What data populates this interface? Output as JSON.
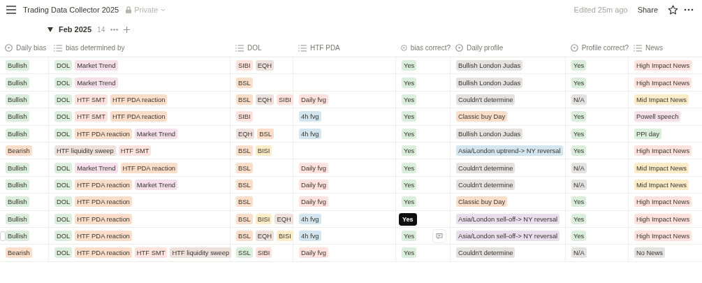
{
  "topbar": {
    "title": "Trading Data Collector 2025",
    "privacy": "Private",
    "edited": "Edited 25m ago",
    "share": "Share"
  },
  "group": {
    "label": "Feb 2025",
    "count": "14",
    "expanded": true
  },
  "columns": [
    {
      "label": "Daily bias",
      "kind": "select"
    },
    {
      "label": "bias determined by",
      "kind": "multi"
    },
    {
      "label": "DOL",
      "kind": "multi"
    },
    {
      "label": "HTF PDA",
      "kind": "multi"
    },
    {
      "label": "bias correct?",
      "kind": "select"
    },
    {
      "label": "Daily profile",
      "kind": "select"
    },
    {
      "label": "Profile correct?",
      "kind": "select"
    },
    {
      "label": "News",
      "kind": "multi"
    }
  ],
  "rows": [
    {
      "cells": [
        [
          {
            "label": "Bullish",
            "color": "#dbeddb"
          }
        ],
        [
          {
            "label": "DOL",
            "color": "#dbeddb"
          },
          {
            "label": "Market Trend",
            "color": "#f5e0e9"
          }
        ],
        [
          {
            "label": "SIBI",
            "color": "#ffe2dd"
          },
          {
            "label": "EQH",
            "color": "#eee0da"
          }
        ],
        [],
        [
          {
            "label": "Yes",
            "color": "#dbeddb"
          }
        ],
        [
          {
            "label": "Bullish London Judas",
            "color": "#e3e2e0"
          }
        ],
        [
          {
            "label": "Yes",
            "color": "#dbeddb"
          }
        ],
        [
          {
            "label": "High Impact News",
            "color": "#ffe2dd"
          }
        ]
      ]
    },
    {
      "cells": [
        [
          {
            "label": "Bullish",
            "color": "#dbeddb"
          }
        ],
        [
          {
            "label": "DOL",
            "color": "#dbeddb"
          },
          {
            "label": "Market Trend",
            "color": "#f5e0e9"
          }
        ],
        [
          {
            "label": "BSL",
            "color": "#fadec9"
          }
        ],
        [],
        [
          {
            "label": "Yes",
            "color": "#dbeddb"
          }
        ],
        [
          {
            "label": "Bullish London Judas",
            "color": "#e3e2e0"
          }
        ],
        [
          {
            "label": "Yes",
            "color": "#dbeddb"
          }
        ],
        [
          {
            "label": "High Impact News",
            "color": "#ffe2dd"
          }
        ]
      ]
    },
    {
      "cells": [
        [
          {
            "label": "Bullish",
            "color": "#dbeddb"
          }
        ],
        [
          {
            "label": "DOL",
            "color": "#dbeddb"
          },
          {
            "label": "HTF SMT",
            "color": "#ffe2dd"
          },
          {
            "label": "HTF PDA reaction",
            "color": "#fadec9"
          }
        ],
        [
          {
            "label": "BSL",
            "color": "#fadec9"
          },
          {
            "label": "EQH",
            "color": "#eee0da"
          },
          {
            "label": "SIBI",
            "color": "#ffe2dd"
          }
        ],
        [
          {
            "label": "Daily fvg",
            "color": "#ffe2dd"
          }
        ],
        [
          {
            "label": "Yes",
            "color": "#dbeddb"
          }
        ],
        [
          {
            "label": "Couldn't determine",
            "color": "#e3e2e0"
          }
        ],
        [
          {
            "label": "N/A",
            "color": "#e3e2e0"
          }
        ],
        [
          {
            "label": "Mid Impact News",
            "color": "#fdecc8"
          }
        ]
      ]
    },
    {
      "cells": [
        [
          {
            "label": "Bullish",
            "color": "#dbeddb"
          }
        ],
        [
          {
            "label": "DOL",
            "color": "#dbeddb"
          },
          {
            "label": "HTF SMT",
            "color": "#ffe2dd"
          },
          {
            "label": "HTF PDA reaction",
            "color": "#fadec9"
          }
        ],
        [
          {
            "label": "SIBI",
            "color": "#ffe2dd"
          }
        ],
        [
          {
            "label": "4h fvg",
            "color": "#d3e5ef"
          }
        ],
        [
          {
            "label": "Yes",
            "color": "#dbeddb"
          }
        ],
        [
          {
            "label": "Classic buy Day",
            "color": "#fadec9"
          }
        ],
        [
          {
            "label": "Yes",
            "color": "#dbeddb"
          }
        ],
        [
          {
            "label": "Powell speech",
            "color": "#f5e0e9"
          }
        ]
      ]
    },
    {
      "cells": [
        [
          {
            "label": "Bullish",
            "color": "#dbeddb"
          }
        ],
        [
          {
            "label": "DOL",
            "color": "#dbeddb"
          },
          {
            "label": "HTF PDA reaction",
            "color": "#fadec9"
          },
          {
            "label": "Market Trend",
            "color": "#f5e0e9"
          }
        ],
        [
          {
            "label": "EQH",
            "color": "#eee0da"
          },
          {
            "label": "BSL",
            "color": "#fadec9"
          }
        ],
        [
          {
            "label": "4h fvg",
            "color": "#d3e5ef"
          }
        ],
        [
          {
            "label": "Yes",
            "color": "#dbeddb"
          }
        ],
        [
          {
            "label": "Bullish London Judas",
            "color": "#e3e2e0"
          }
        ],
        [
          {
            "label": "Yes",
            "color": "#dbeddb"
          }
        ],
        [
          {
            "label": "PPI day",
            "color": "#dbeddb"
          }
        ]
      ]
    },
    {
      "cells": [
        [
          {
            "label": "Bearish",
            "color": "#fadec9"
          }
        ],
        [
          {
            "label": "HTF liquidity sweep",
            "color": "#eee0da"
          },
          {
            "label": "HTF SMT",
            "color": "#ffe2dd"
          }
        ],
        [
          {
            "label": "BSL",
            "color": "#fadec9"
          },
          {
            "label": "BISI",
            "color": "#fdecc8"
          }
        ],
        [],
        [
          {
            "label": "Yes",
            "color": "#dbeddb"
          }
        ],
        [
          {
            "label": "Asia/London uptrend-> NY reversal",
            "color": "#d3e5ef"
          }
        ],
        [
          {
            "label": "Yes",
            "color": "#dbeddb"
          }
        ],
        [
          {
            "label": "High Impact News",
            "color": "#ffe2dd"
          }
        ]
      ]
    },
    {
      "cells": [
        [
          {
            "label": "Bullish",
            "color": "#dbeddb"
          }
        ],
        [
          {
            "label": "DOL",
            "color": "#dbeddb"
          },
          {
            "label": "Market Trend",
            "color": "#f5e0e9"
          },
          {
            "label": "HTF PDA reaction",
            "color": "#fadec9"
          }
        ],
        [
          {
            "label": "BSL",
            "color": "#fadec9"
          }
        ],
        [
          {
            "label": "Daily fvg",
            "color": "#ffe2dd"
          }
        ],
        [
          {
            "label": "Yes",
            "color": "#dbeddb"
          }
        ],
        [
          {
            "label": "Couldn't determine",
            "color": "#e3e2e0"
          }
        ],
        [
          {
            "label": "N/A",
            "color": "#e3e2e0"
          }
        ],
        [
          {
            "label": "Mid Impact News",
            "color": "#fdecc8"
          }
        ]
      ]
    },
    {
      "cells": [
        [
          {
            "label": "Bullish",
            "color": "#dbeddb"
          }
        ],
        [
          {
            "label": "DOL",
            "color": "#dbeddb"
          },
          {
            "label": "HTF PDA reaction",
            "color": "#fadec9"
          },
          {
            "label": "Market Trend",
            "color": "#f5e0e9"
          }
        ],
        [
          {
            "label": "BSL",
            "color": "#fadec9"
          }
        ],
        [
          {
            "label": "Daily fvg",
            "color": "#ffe2dd"
          }
        ],
        [
          {
            "label": "Yes",
            "color": "#dbeddb"
          }
        ],
        [
          {
            "label": "Couldn't determine",
            "color": "#e3e2e0"
          }
        ],
        [
          {
            "label": "N/A",
            "color": "#e3e2e0"
          }
        ],
        [
          {
            "label": "Mid Impact News",
            "color": "#fdecc8"
          }
        ]
      ]
    },
    {
      "cells": [
        [
          {
            "label": "Bullish",
            "color": "#dbeddb"
          }
        ],
        [
          {
            "label": "DOL",
            "color": "#dbeddb"
          },
          {
            "label": "HTF PDA reaction",
            "color": "#fadec9"
          }
        ],
        [
          {
            "label": "BSL",
            "color": "#fadec9"
          }
        ],
        [
          {
            "label": "Daily fvg",
            "color": "#ffe2dd"
          }
        ],
        [
          {
            "label": "Yes",
            "color": "#dbeddb"
          }
        ],
        [
          {
            "label": "Classic buy Day",
            "color": "#fadec9"
          }
        ],
        [
          {
            "label": "Yes",
            "color": "#dbeddb"
          }
        ],
        [
          {
            "label": "High Impact News",
            "color": "#ffe2dd"
          }
        ]
      ]
    },
    {
      "tooltip": "Yes",
      "cells": [
        [
          {
            "label": "Bullish",
            "color": "#dbeddb"
          }
        ],
        [
          {
            "label": "DOL",
            "color": "#dbeddb"
          },
          {
            "label": "HTF PDA reaction",
            "color": "#fadec9"
          }
        ],
        [
          {
            "label": "BSL",
            "color": "#fadec9"
          },
          {
            "label": "BISI",
            "color": "#fdecc8"
          },
          {
            "label": "EQH",
            "color": "#eee0da"
          }
        ],
        [
          {
            "label": "4h fvg",
            "color": "#d3e5ef"
          }
        ],
        [],
        [
          {
            "label": "Asia/London sell-off-> NY reversal",
            "color": "#e8deee"
          }
        ],
        [
          {
            "label": "Yes",
            "color": "#dbeddb"
          }
        ],
        [
          {
            "label": "High Impact News",
            "color": "#ffe2dd"
          }
        ]
      ]
    },
    {
      "hovered": true,
      "checked": false,
      "cells": [
        [
          {
            "label": "Bullish",
            "color": "#dbeddb"
          }
        ],
        [
          {
            "label": "DOL",
            "color": "#dbeddb"
          },
          {
            "label": "HTF PDA reaction",
            "color": "#fadec9"
          }
        ],
        [
          {
            "label": "BSL",
            "color": "#fadec9"
          },
          {
            "label": "EQH",
            "color": "#eee0da"
          },
          {
            "label": "BISI",
            "color": "#fdecc8"
          }
        ],
        [
          {
            "label": "4h fvg",
            "color": "#d3e5ef"
          }
        ],
        [
          {
            "label": "Yes",
            "color": "#dbeddb"
          }
        ],
        [
          {
            "label": "Asia/London sell-off-> NY reversal",
            "color": "#e8deee"
          }
        ],
        [
          {
            "label": "Yes",
            "color": "#dbeddb"
          }
        ],
        [
          {
            "label": "High Impact News",
            "color": "#ffe2dd"
          }
        ]
      ]
    },
    {
      "cells": [
        [
          {
            "label": "Bearish",
            "color": "#fadec9"
          }
        ],
        [
          {
            "label": "DOL",
            "color": "#dbeddb"
          },
          {
            "label": "HTF PDA reaction",
            "color": "#fadec9"
          },
          {
            "label": "HTF SMT",
            "color": "#ffe2dd"
          },
          {
            "label": "HTF liquidity sweep",
            "color": "#eee0da"
          }
        ],
        [
          {
            "label": "SSL",
            "color": "#dbeddb"
          },
          {
            "label": "SIBI",
            "color": "#ffe2dd"
          }
        ],
        [
          {
            "label": "Daily fvg",
            "color": "#ffe2dd"
          }
        ],
        [
          {
            "label": "Yes",
            "color": "#dbeddb"
          }
        ],
        [
          {
            "label": "Couldn't determine",
            "color": "#e3e2e0"
          }
        ],
        [
          {
            "label": "N/A",
            "color": "#e3e2e0"
          }
        ],
        [
          {
            "label": "No News",
            "color": "#e3e2e0"
          }
        ]
      ]
    }
  ]
}
